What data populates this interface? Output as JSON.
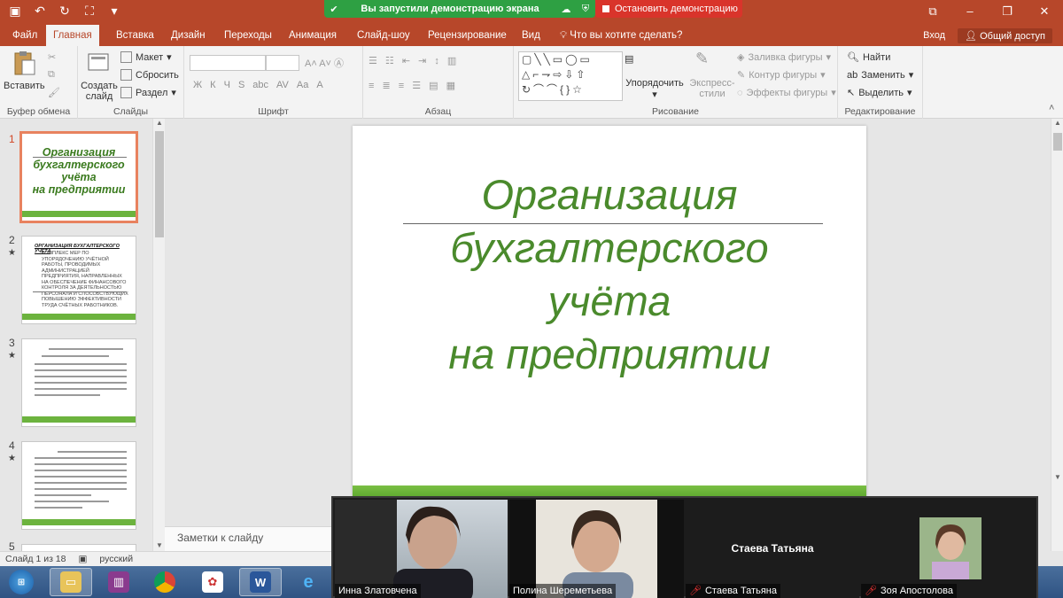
{
  "colors": {
    "accent": "#b7472a",
    "slide_green": "#4a8a2c",
    "banner_green": "#2ea043",
    "stop_red": "#d9342b"
  },
  "share_banner": {
    "text": "Вы запустили демонстрацию экрана",
    "stop_label": "Остановить демонстрацию"
  },
  "tabs": [
    {
      "label": "Файл"
    },
    {
      "label": "Главная"
    },
    {
      "label": "Вставка"
    },
    {
      "label": "Дизайн"
    },
    {
      "label": "Переходы"
    },
    {
      "label": "Анимация"
    },
    {
      "label": "Слайд-шоу"
    },
    {
      "label": "Рецензирование"
    },
    {
      "label": "Вид"
    },
    {
      "label": "Что вы хотите сделать?"
    }
  ],
  "account": {
    "signin": "Вход",
    "share": "Общий доступ"
  },
  "ribbon": {
    "clipboard": {
      "label": "Буфер обмена",
      "paste": "Вставить"
    },
    "slides": {
      "label": "Слайды",
      "new_slide_1": "Создать",
      "new_slide_2": "слайд",
      "layout": "Макет",
      "reset": "Сбросить",
      "section": "Раздел"
    },
    "font": {
      "label": "Шрифт",
      "buttons": [
        "Ж",
        "К",
        "Ч",
        "S",
        "abc",
        "AV",
        "Aa",
        "A"
      ]
    },
    "paragraph": {
      "label": "Абзац"
    },
    "drawing": {
      "label": "Рисование",
      "arrange": "Упорядочить",
      "quick_styles_1": "Экспресс-",
      "quick_styles_2": "стили",
      "fill": "Заливка фигуры",
      "outline": "Контур фигуры",
      "effects": "Эффекты фигуры"
    },
    "editing": {
      "label": "Редактирование",
      "find": "Найти",
      "replace": "Заменить",
      "select": "Выделить"
    }
  },
  "thumbnails": [
    {
      "number": "1",
      "title_lines": [
        "Организация",
        "бухгалтерского",
        "учёта",
        "на предприятии"
      ]
    },
    {
      "number": "2",
      "title": "ОРГАНИЗАЦИЯ БУХГАЛТЕРСКОГО УЧЁТА",
      "body": "КОМПЛЕКС МЕР ПО УПОРЯДОЧЕНИЮ УЧЁТНОЙ РАБОТЫ, ПРОВОДИМЫХ АДМИНИСТРАЦИЕЙ ПРЕДПРИЯТИЯ, НАПРАВЛЕННЫХ НА ОБЕСПЕЧЕНИЕ ФИНАНСОВОГО КОНТРОЛЯ ЗА ДЕЯТЕЛЬНОСТЬЮ ПЕРСОНАЛА И СПОСОБСТВУЮЩИХ ПОВЫШЕНИЮ ЭФФЕКТИВНОСТИ ТРУДА СЧЁТНЫХ РАБОТНИКОВ."
    },
    {
      "number": "3"
    },
    {
      "number": "4"
    },
    {
      "number": "5"
    }
  ],
  "slide": {
    "title_lines": [
      "Организация",
      "бухгалтерского",
      "учёта",
      "на предприятии"
    ]
  },
  "notes_placeholder": "Заметки к слайду",
  "status": {
    "slide_of": "Слайд 1 из 18",
    "language": "русский"
  },
  "participants": [
    {
      "name": "Инна Златовчена",
      "muted": false,
      "video": true
    },
    {
      "name": "Полина Шереметьева",
      "muted": false,
      "video": true
    },
    {
      "name": "Стаева Татьяна",
      "muted": true,
      "video": false,
      "center_label": "Стаева Татьяна"
    },
    {
      "name": "Зоя Апостолова",
      "muted": true,
      "video": true
    }
  ]
}
